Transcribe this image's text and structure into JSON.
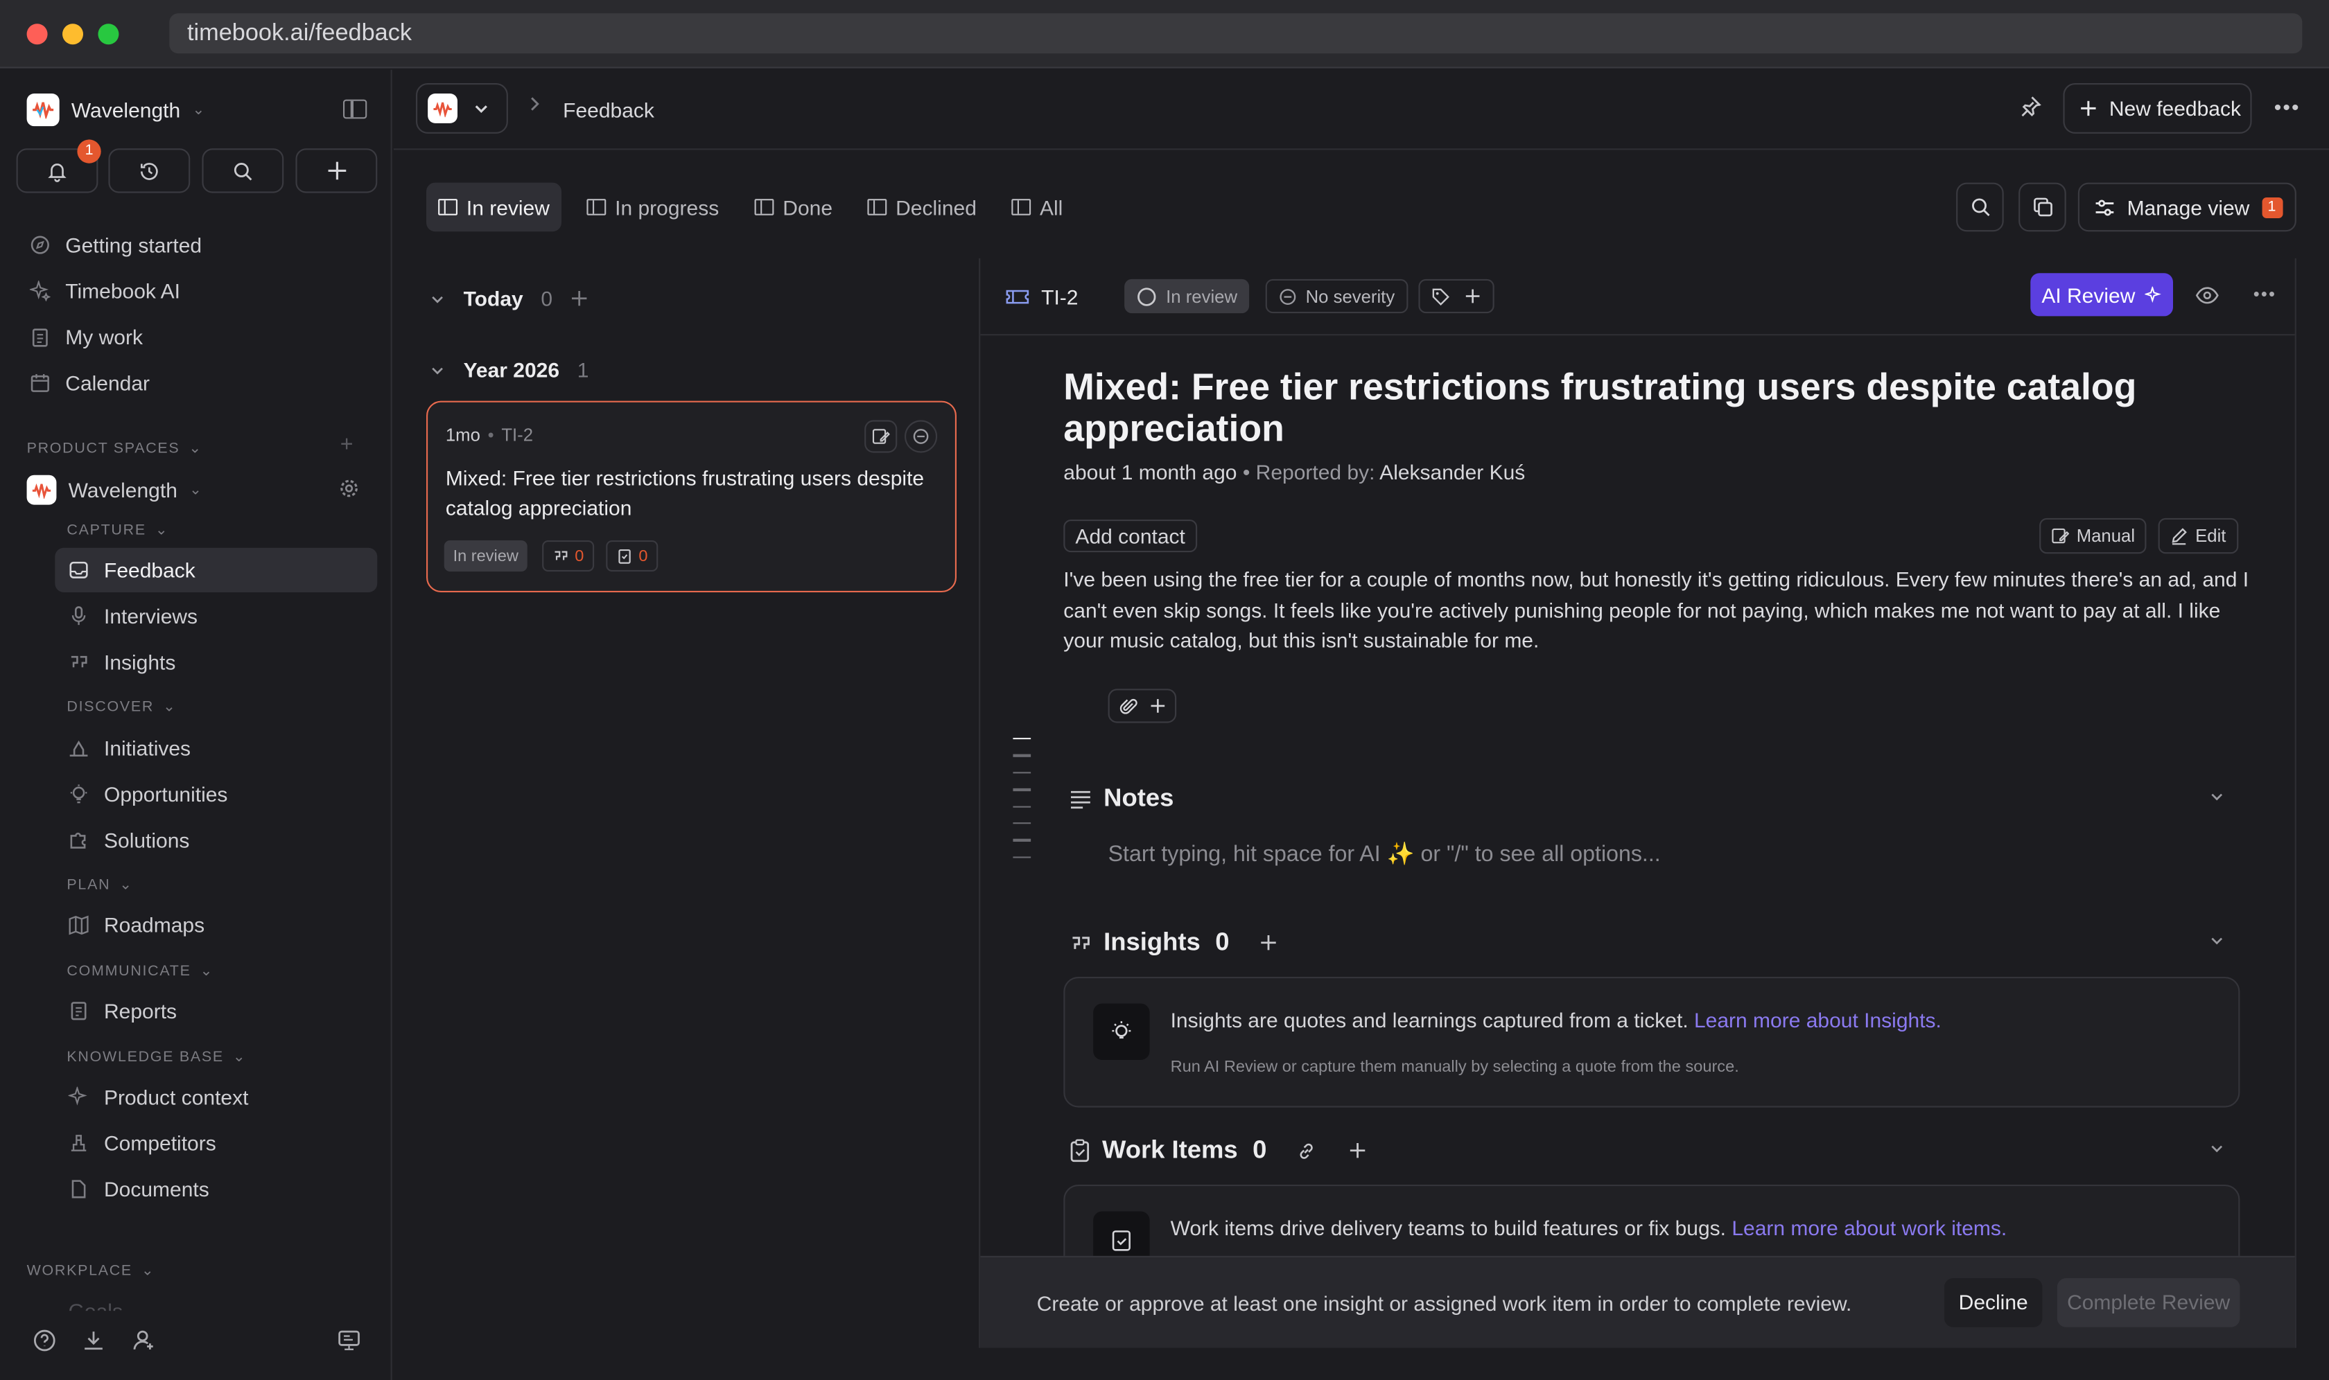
{
  "browser": {
    "url": "timebook.ai/feedback"
  },
  "colors": {
    "accent": "#5b3fe0",
    "alert": "#e4572e",
    "card_border": "#e86a4e",
    "link": "#8b7af0"
  },
  "sidebar": {
    "workspace": "Wavelength",
    "notification_count": "1",
    "nav": [
      {
        "label": "Getting started",
        "icon": "compass-icon"
      },
      {
        "label": "Timebook AI",
        "icon": "sparkle-icon"
      },
      {
        "label": "My work",
        "icon": "clipboard-icon"
      },
      {
        "label": "Calendar",
        "icon": "calendar-icon"
      }
    ],
    "product_spaces_label": "PRODUCT SPACES",
    "space_name": "Wavelength",
    "capture_label": "CAPTURE",
    "capture": [
      "Feedback",
      "Interviews",
      "Insights"
    ],
    "discover_label": "DISCOVER",
    "discover": [
      "Initiatives",
      "Opportunities",
      "Solutions"
    ],
    "plan_label": "PLAN",
    "plan": [
      "Roadmaps"
    ],
    "communicate_label": "COMMUNICATE",
    "communicate": [
      "Reports"
    ],
    "kb_label": "KNOWLEDGE BASE",
    "kb": [
      "Product context",
      "Competitors",
      "Documents"
    ],
    "workplace_label": "WORKPLACE",
    "workplace_partial": "Goals"
  },
  "topbar": {
    "crumb": "Feedback",
    "new_feedback": "New feedback"
  },
  "tabs": [
    "In review",
    "In progress",
    "Done",
    "Declined",
    "All"
  ],
  "manage_view": {
    "label": "Manage view",
    "count": "1"
  },
  "list": {
    "groups": [
      {
        "title": "Today",
        "count": "0"
      },
      {
        "title": "Year 2026",
        "count": "1"
      }
    ],
    "card": {
      "age": "1mo",
      "id": "TI-2",
      "title": "Mixed: Free tier restrictions frustrating users despite catalog appreciation",
      "status": "In review",
      "insights": "0",
      "work_items": "0"
    }
  },
  "detail": {
    "id": "TI-2",
    "status": "In review",
    "severity": "No severity",
    "ai_review": "AI Review",
    "title": "Mixed: Free tier restrictions frustrating users despite catalog appreciation",
    "time": "about 1 month ago",
    "reported_label": "Reported by:",
    "reporter": "Aleksander Kuś",
    "add_contact": "Add contact",
    "manual": "Manual",
    "edit": "Edit",
    "body": "I've been using the free tier for a couple of months now, but honestly it's getting ridiculous. Every few minutes there's an ad, and I can't even skip songs. It feels like you're actively punishing people for not paying, which makes me not want to pay at all. I like your music catalog, but this isn't sustainable for me.",
    "notes_title": "Notes",
    "notes_placeholder": "Start typing, hit space for AI ✨  or \"/\" to see all options...",
    "insights_title": "Insights",
    "insights_count": "0",
    "insights_info": "Insights are quotes and learnings captured from a ticket.",
    "insights_link": "Learn more about Insights.",
    "insights_hint": "Run AI Review or capture them manually by selecting a quote from the source.",
    "work_title": "Work Items",
    "work_count": "0",
    "work_info": "Work items drive delivery teams to build features or fix bugs.",
    "work_link": "Learn more about work items.",
    "footer_msg": "Create or approve at least one insight or assigned work item in order to complete review.",
    "decline": "Decline",
    "complete": "Complete Review"
  }
}
